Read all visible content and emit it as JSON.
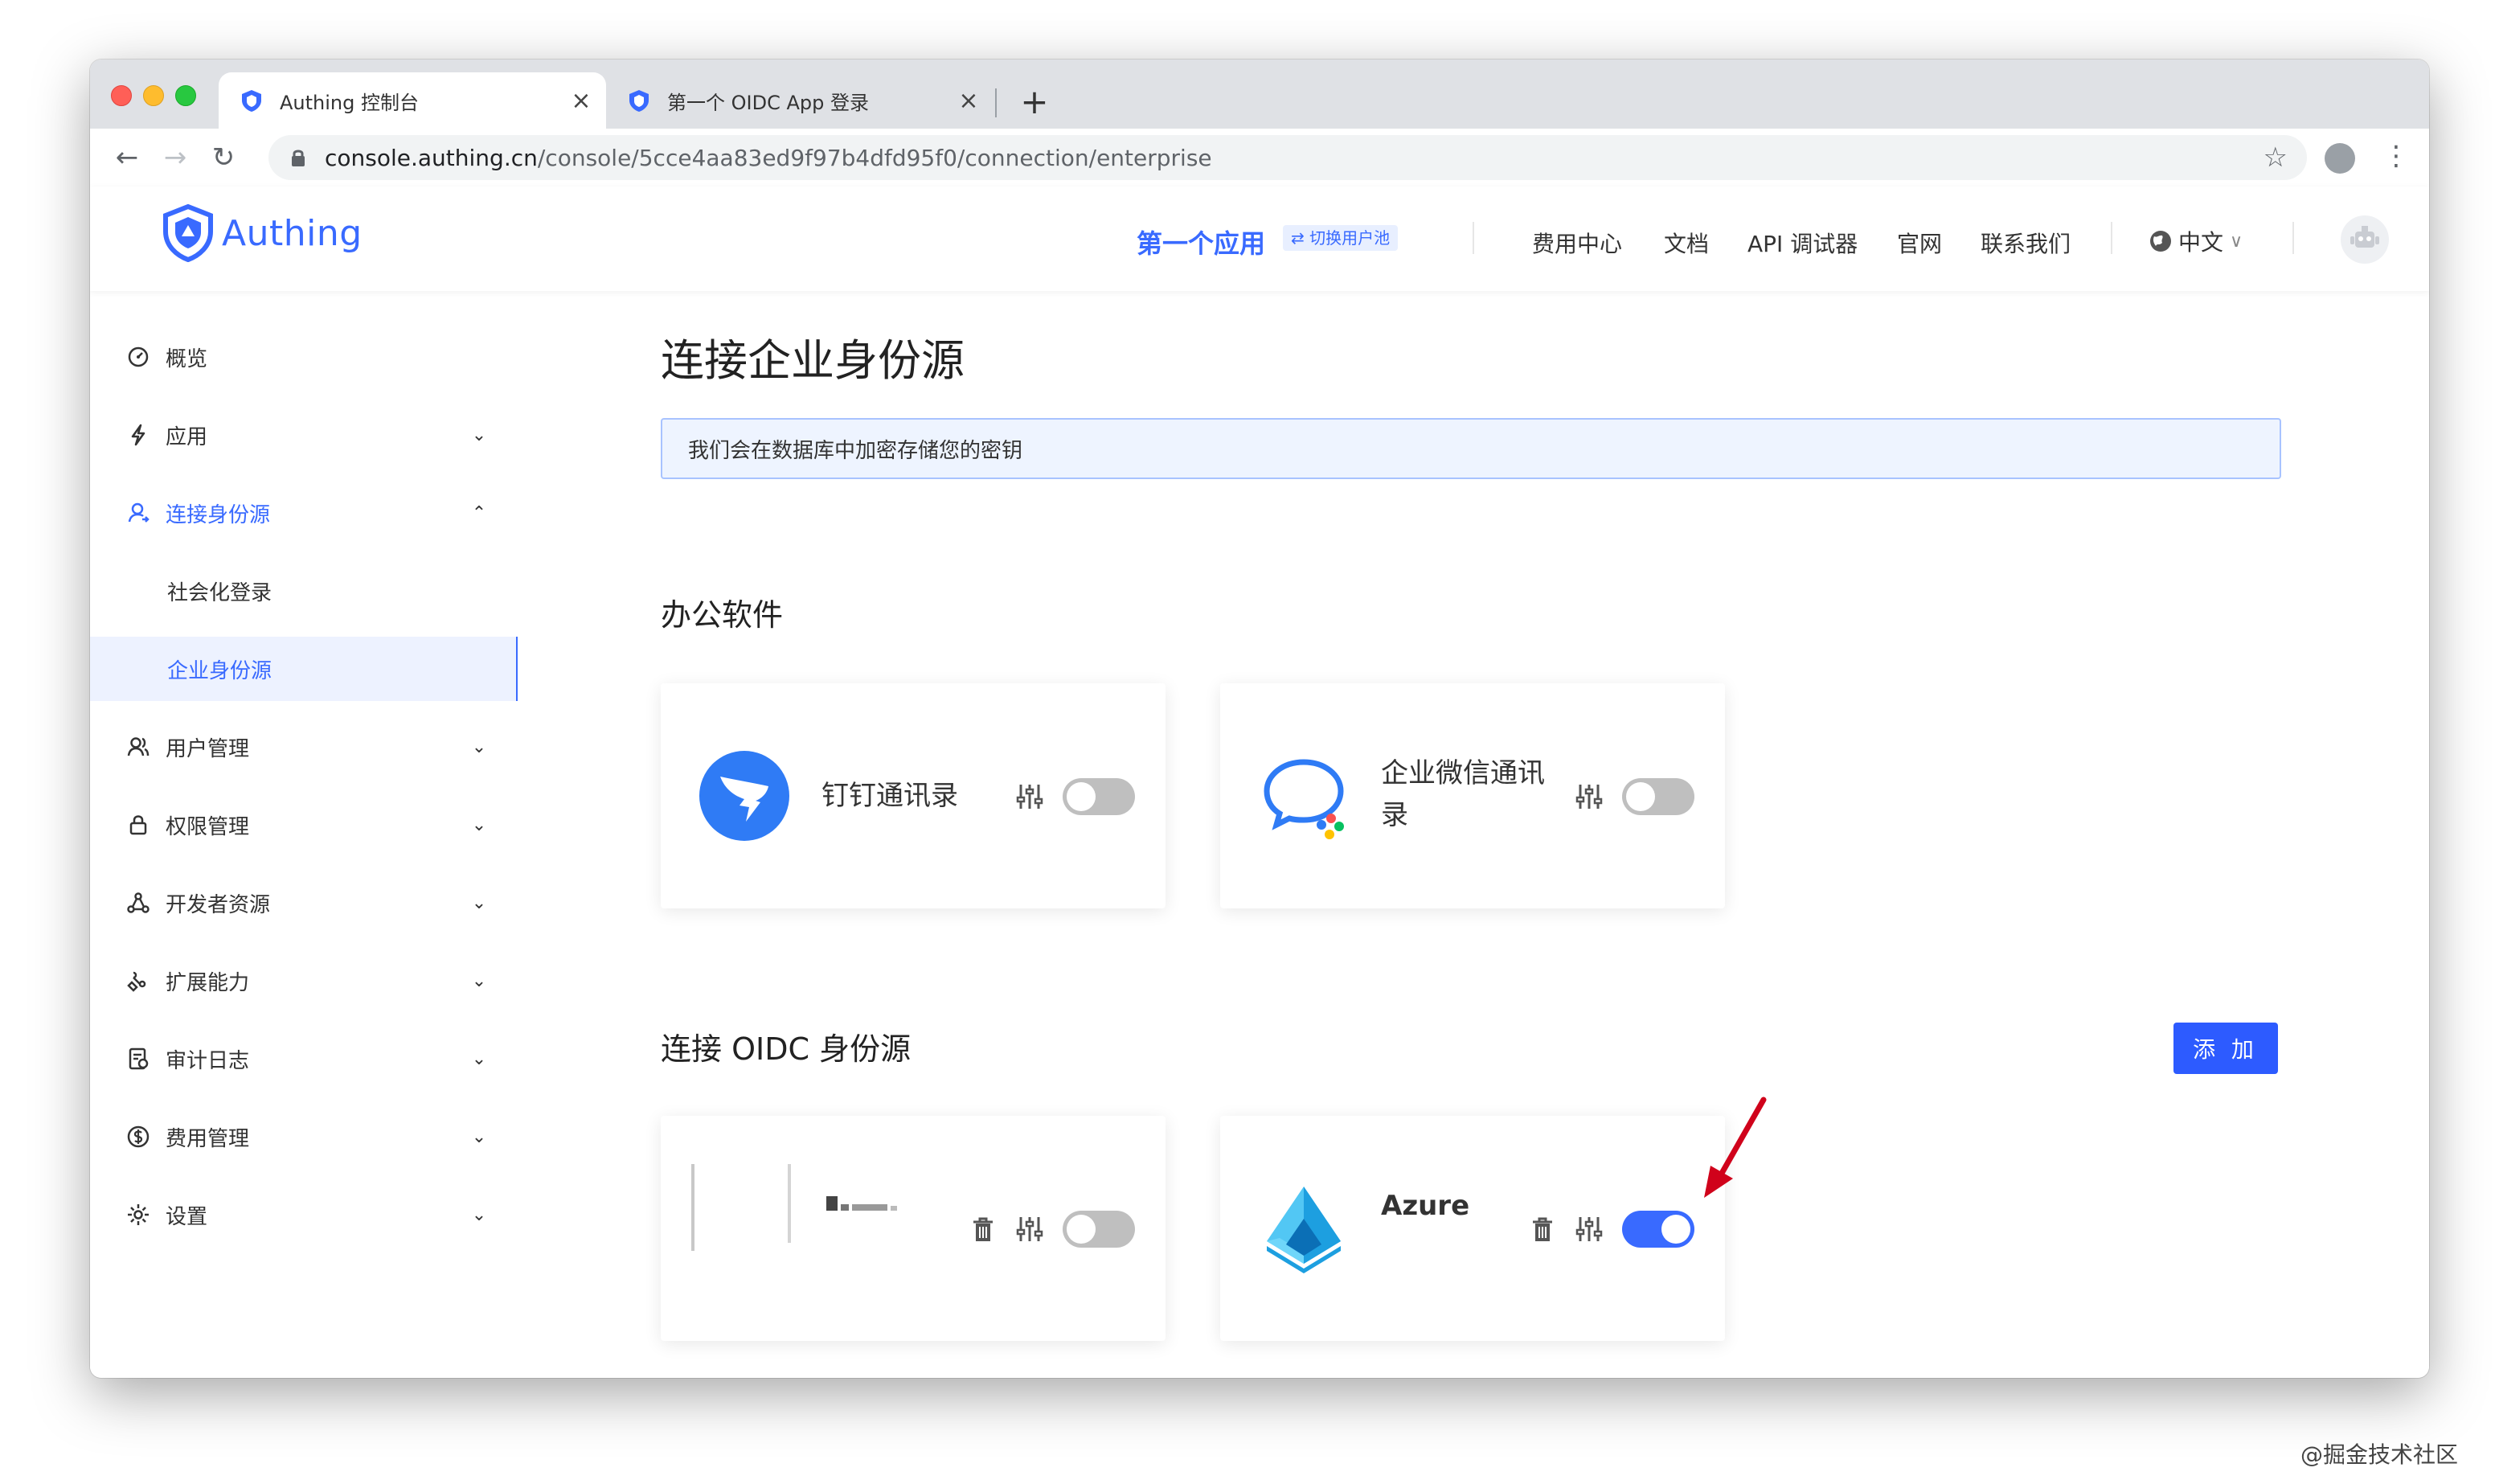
{
  "browser": {
    "tabs": [
      {
        "title": "Authing 控制台",
        "active": true
      },
      {
        "title": "第一个 OIDC App 登录",
        "active": false
      }
    ],
    "url_host": "console.authing.cn",
    "url_path": "/console/5cce4aa83ed9f97b4dfd95f0/connection/enterprise"
  },
  "header": {
    "logo_text": "Authing",
    "app_name": "第一个应用",
    "switch_pool": "⇄ 切换用户池",
    "links": [
      "费用中心",
      "文档",
      "API 调试器",
      "官网",
      "联系我们"
    ],
    "language": "中文"
  },
  "sidebar": {
    "items": [
      {
        "label": "概览"
      },
      {
        "label": "应用"
      },
      {
        "label": "连接身份源"
      },
      {
        "label": "社会化登录"
      },
      {
        "label": "企业身份源"
      },
      {
        "label": "用户管理"
      },
      {
        "label": "权限管理"
      },
      {
        "label": "开发者资源"
      },
      {
        "label": "扩展能力"
      },
      {
        "label": "审计日志"
      },
      {
        "label": "费用管理"
      },
      {
        "label": "设置"
      }
    ]
  },
  "main": {
    "title": "连接企业身份源",
    "alert": "我们会在数据库中加密存储您的密钥",
    "office_section": "办公软件",
    "office_cards": [
      {
        "name": "钉钉通讯录",
        "enabled": false
      },
      {
        "name_line1": "企业微信通讯",
        "name_line2": "录",
        "enabled": false
      }
    ],
    "oidc_section": "连接 OIDC 身份源",
    "add_button": "添 加",
    "oidc_cards": [
      {
        "name": "",
        "enabled": false
      },
      {
        "name": "Azure",
        "enabled": true
      }
    ]
  },
  "watermark": "@掘金技术社区",
  "colors": {
    "accent": "#396aff",
    "button": "#2d5bff",
    "arrow": "#d0021b"
  }
}
